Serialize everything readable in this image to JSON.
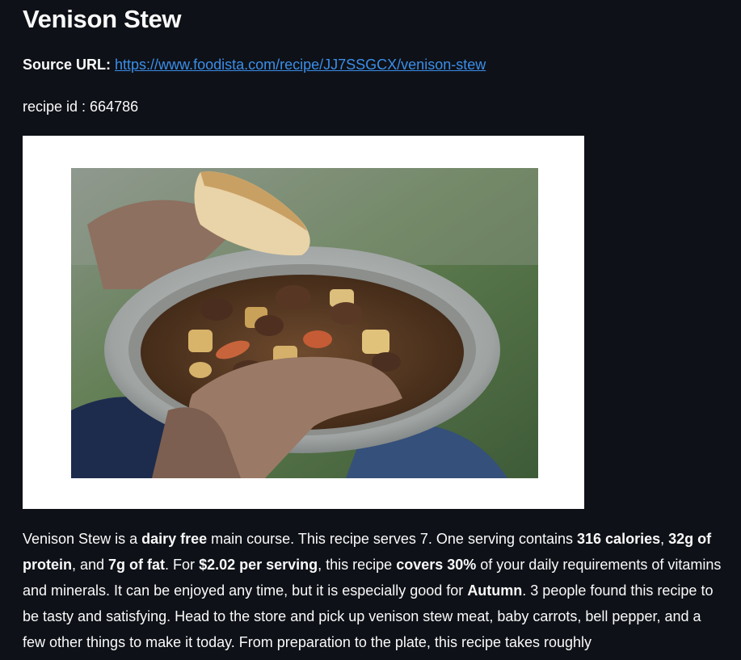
{
  "recipe": {
    "title": "Venison Stew",
    "source_label": "Source URL:",
    "source_url": "https://www.foodista.com/recipe/JJ7SSGCX/venison-stew",
    "recipe_id_text": "recipe id : 664786",
    "image_alt": "Venison Stew"
  },
  "summary": {
    "p1": "Venison Stew is a ",
    "b1": "dairy free",
    "p2": " main course. This recipe serves 7. One serving contains ",
    "b2": "316 calories",
    "p3": ", ",
    "b3": "32g of protein",
    "p4": ", and ",
    "b4": "7g of fat",
    "p5": ". For ",
    "b5": "$2.02 per serving",
    "p6": ", this recipe ",
    "b6": "covers 30%",
    "p7": " of your daily requirements of vitamins and minerals. It can be enjoyed any time, but it is especially good for ",
    "b7": "Autumn",
    "p8": ". 3 people found this recipe to be tasty and satisfying. Head to the store and pick up venison stew meat, baby carrots, bell pepper, and a few other things to make it today. From preparation to the plate, this recipe takes roughly"
  }
}
